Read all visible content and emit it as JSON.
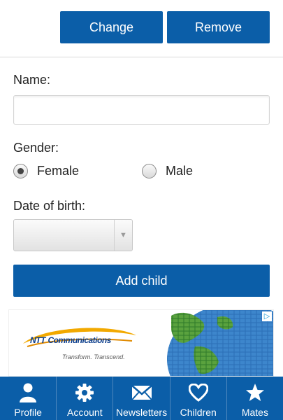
{
  "actions": {
    "change_label": "Change",
    "remove_label": "Remove"
  },
  "form": {
    "name_label": "Name:",
    "name_value": "",
    "gender_label": "Gender:",
    "gender_options": [
      {
        "label": "Female",
        "checked": true
      },
      {
        "label": "Male",
        "checked": false
      }
    ],
    "dob_label": "Date of birth:",
    "dob_value": "",
    "add_label": "Add child"
  },
  "ad": {
    "brand": "NTT",
    "brand_suffix": "Communications",
    "tagline": "Transform. Transcend."
  },
  "tabs": [
    {
      "label": "Profile",
      "icon": "person-icon"
    },
    {
      "label": "Account",
      "icon": "gear-icon"
    },
    {
      "label": "Newsletters",
      "icon": "envelope-icon"
    },
    {
      "label": "Children",
      "icon": "heart-icon"
    },
    {
      "label": "Mates",
      "icon": "star-icon"
    }
  ],
  "colors": {
    "accent": "#0b5ea8"
  }
}
